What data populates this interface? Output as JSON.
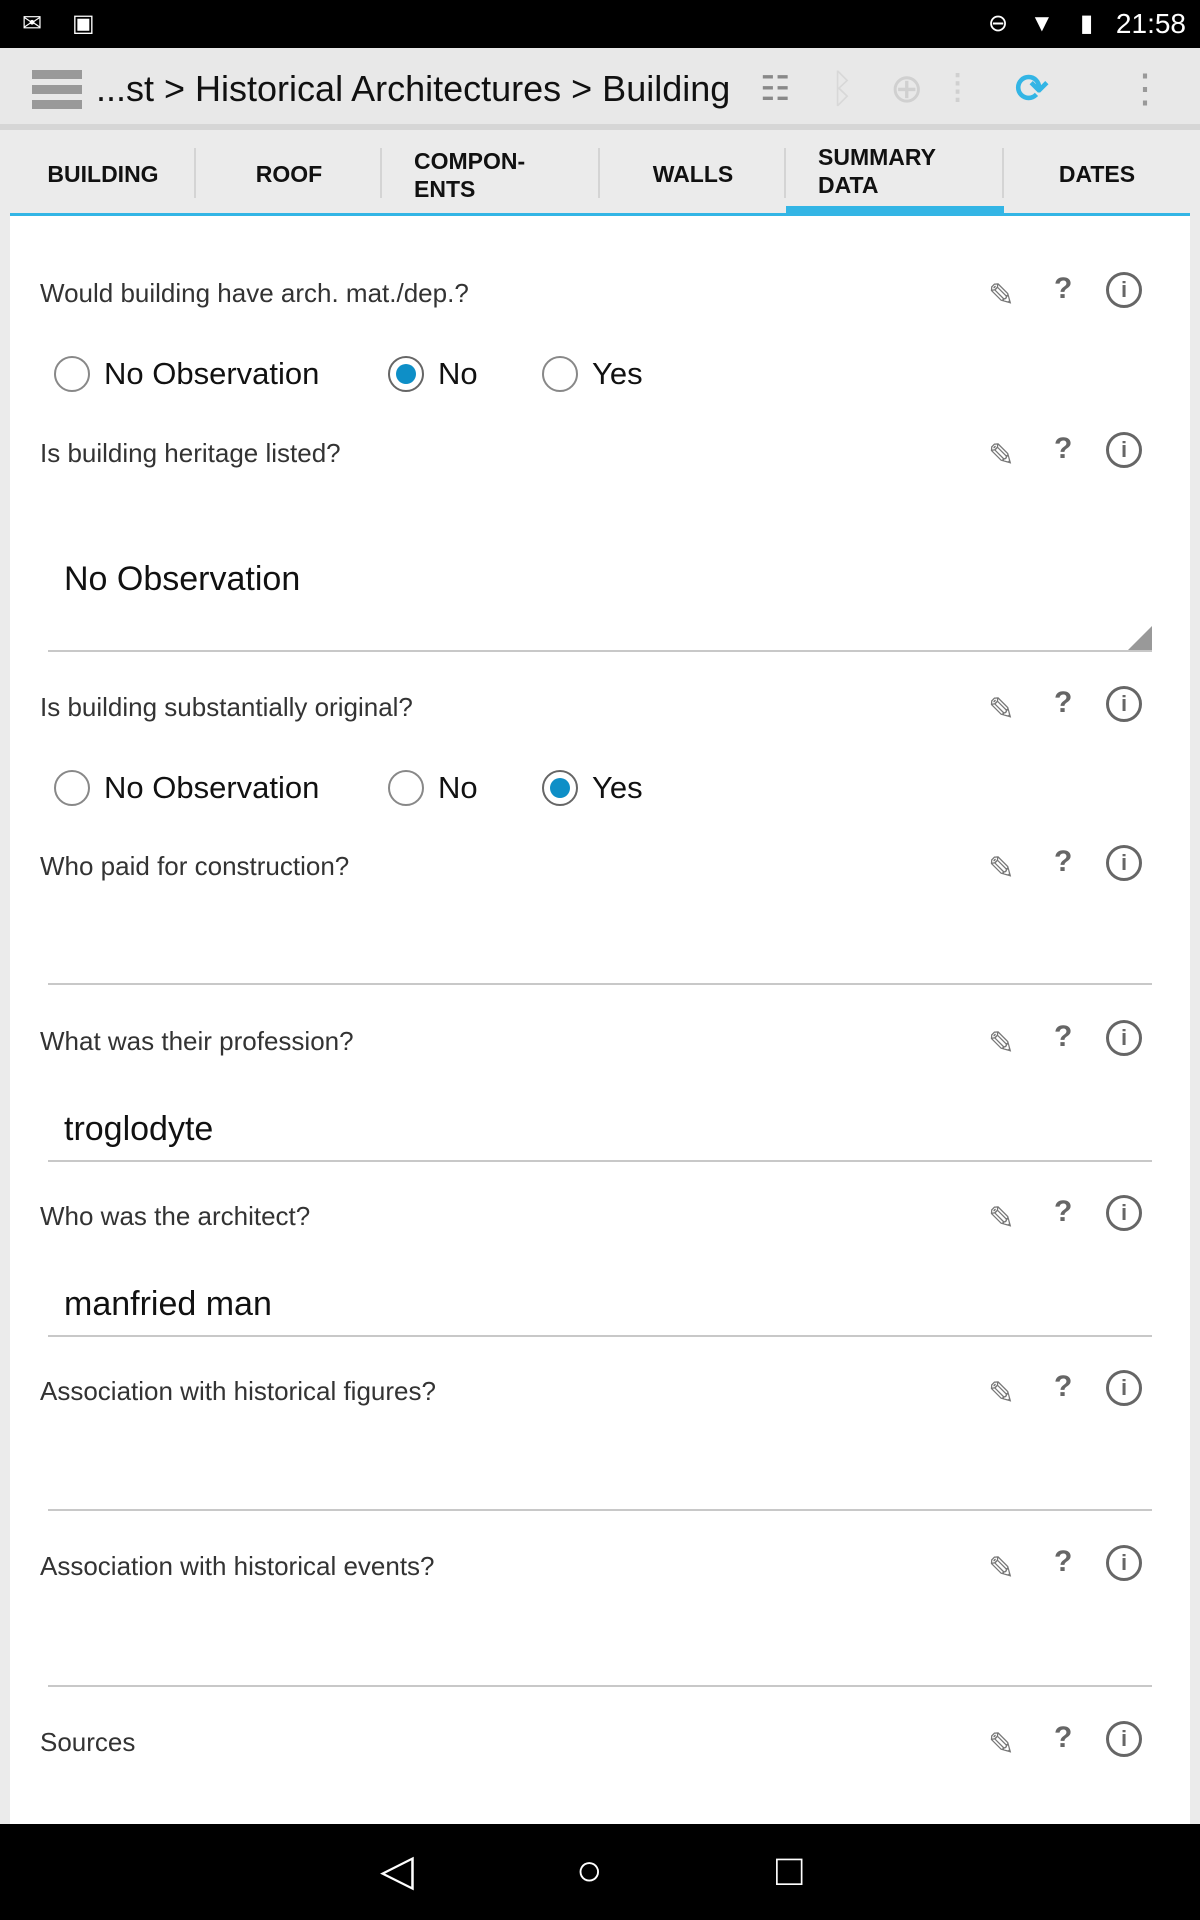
{
  "status_bar": {
    "time": "21:58",
    "icons": [
      "gmail-icon",
      "image-icon",
      "do-not-disturb-icon",
      "wifi-icon",
      "battery-icon"
    ]
  },
  "toolbar": {
    "title": "...st > Historical Architectures > Building",
    "icons": [
      "menu-icon",
      "sync-list-icon",
      "bluetooth-icon",
      "gps-icon",
      "footsteps-icon",
      "sync-icon",
      "overflow-menu-icon"
    ],
    "accent": "#33b5e5"
  },
  "tabs": [
    {
      "label": "BUILDING"
    },
    {
      "label": "ROOF"
    },
    {
      "label": "COMPON-\nENTS"
    },
    {
      "label": "WALLS"
    },
    {
      "label": "SUMMARY\nDATA",
      "active": true
    },
    {
      "label": "DATES"
    }
  ],
  "form": {
    "q1": {
      "label": "Would building have arch. mat./dep.?",
      "options": [
        "No Observation",
        "No",
        "Yes"
      ],
      "selected": "No"
    },
    "q2": {
      "label": "Is building heritage listed?",
      "value": "No Observation"
    },
    "q3": {
      "label": "Is building substantially original?",
      "options": [
        "No Observation",
        "No",
        "Yes"
      ],
      "selected": "Yes"
    },
    "q4": {
      "label": "Who paid for construction?",
      "value": ""
    },
    "q5": {
      "label": "What was their profession?",
      "value": "troglodyte"
    },
    "q6": {
      "label": "Who was the architect?",
      "value": "manfried man"
    },
    "q7": {
      "label": "Association with historical figures?",
      "value": ""
    },
    "q8": {
      "label": "Association with historical events?",
      "value": ""
    },
    "q9": {
      "label": "Sources"
    },
    "row_icons": {
      "edit": "✎",
      "help": "?",
      "info": "i"
    }
  },
  "nav_bar": {
    "icons": [
      "back-icon",
      "home-icon",
      "recents-icon"
    ]
  }
}
